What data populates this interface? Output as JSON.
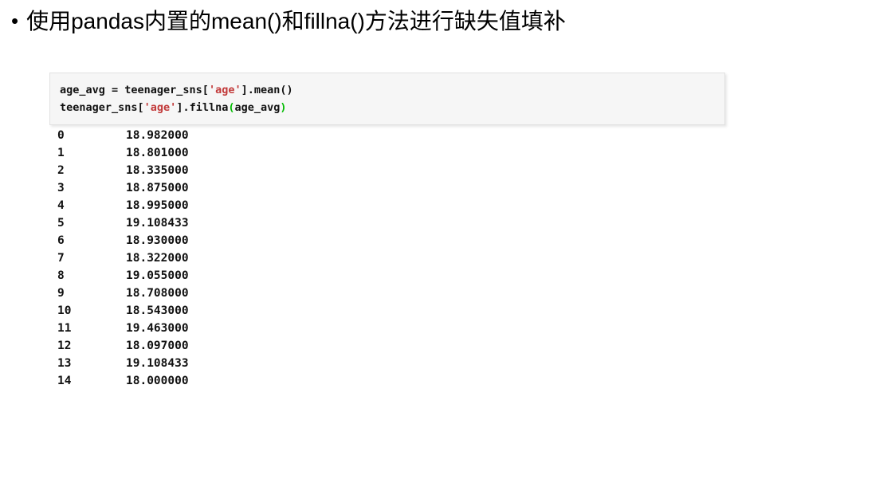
{
  "slide": {
    "bullet_marker": "•",
    "title": "使用pandas内置的mean()和fillna()方法进行缺失值填补",
    "background_color": "#ffffff"
  },
  "code_block": {
    "background_color": "#f6f6f6",
    "border_color": "#e2e2e2",
    "string_color": "#c23a3a",
    "paren_color": "#00bb00",
    "text_color": "#111111",
    "line1": {
      "part_a": "age_avg = teenager_sns[",
      "string": "'age'",
      "part_b": "].mean()"
    },
    "line2": {
      "part_a": "teenager_sns[",
      "string": "'age'",
      "part_b": "].fillna",
      "paren_open": "(",
      "arg": "age_avg",
      "paren_close": ")"
    }
  },
  "output": {
    "rows": [
      {
        "index": "0",
        "value": "18.982000"
      },
      {
        "index": "1",
        "value": "18.801000"
      },
      {
        "index": "2",
        "value": "18.335000"
      },
      {
        "index": "3",
        "value": "18.875000"
      },
      {
        "index": "4",
        "value": "18.995000"
      },
      {
        "index": "5",
        "value": "19.108433"
      },
      {
        "index": "6",
        "value": "18.930000"
      },
      {
        "index": "7",
        "value": "18.322000"
      },
      {
        "index": "8",
        "value": "19.055000"
      },
      {
        "index": "9",
        "value": "18.708000"
      },
      {
        "index": "10",
        "value": "18.543000"
      },
      {
        "index": "11",
        "value": "19.463000"
      },
      {
        "index": "12",
        "value": "18.097000"
      },
      {
        "index": "13",
        "value": "19.108433"
      },
      {
        "index": "14",
        "value": "18.000000"
      }
    ]
  }
}
